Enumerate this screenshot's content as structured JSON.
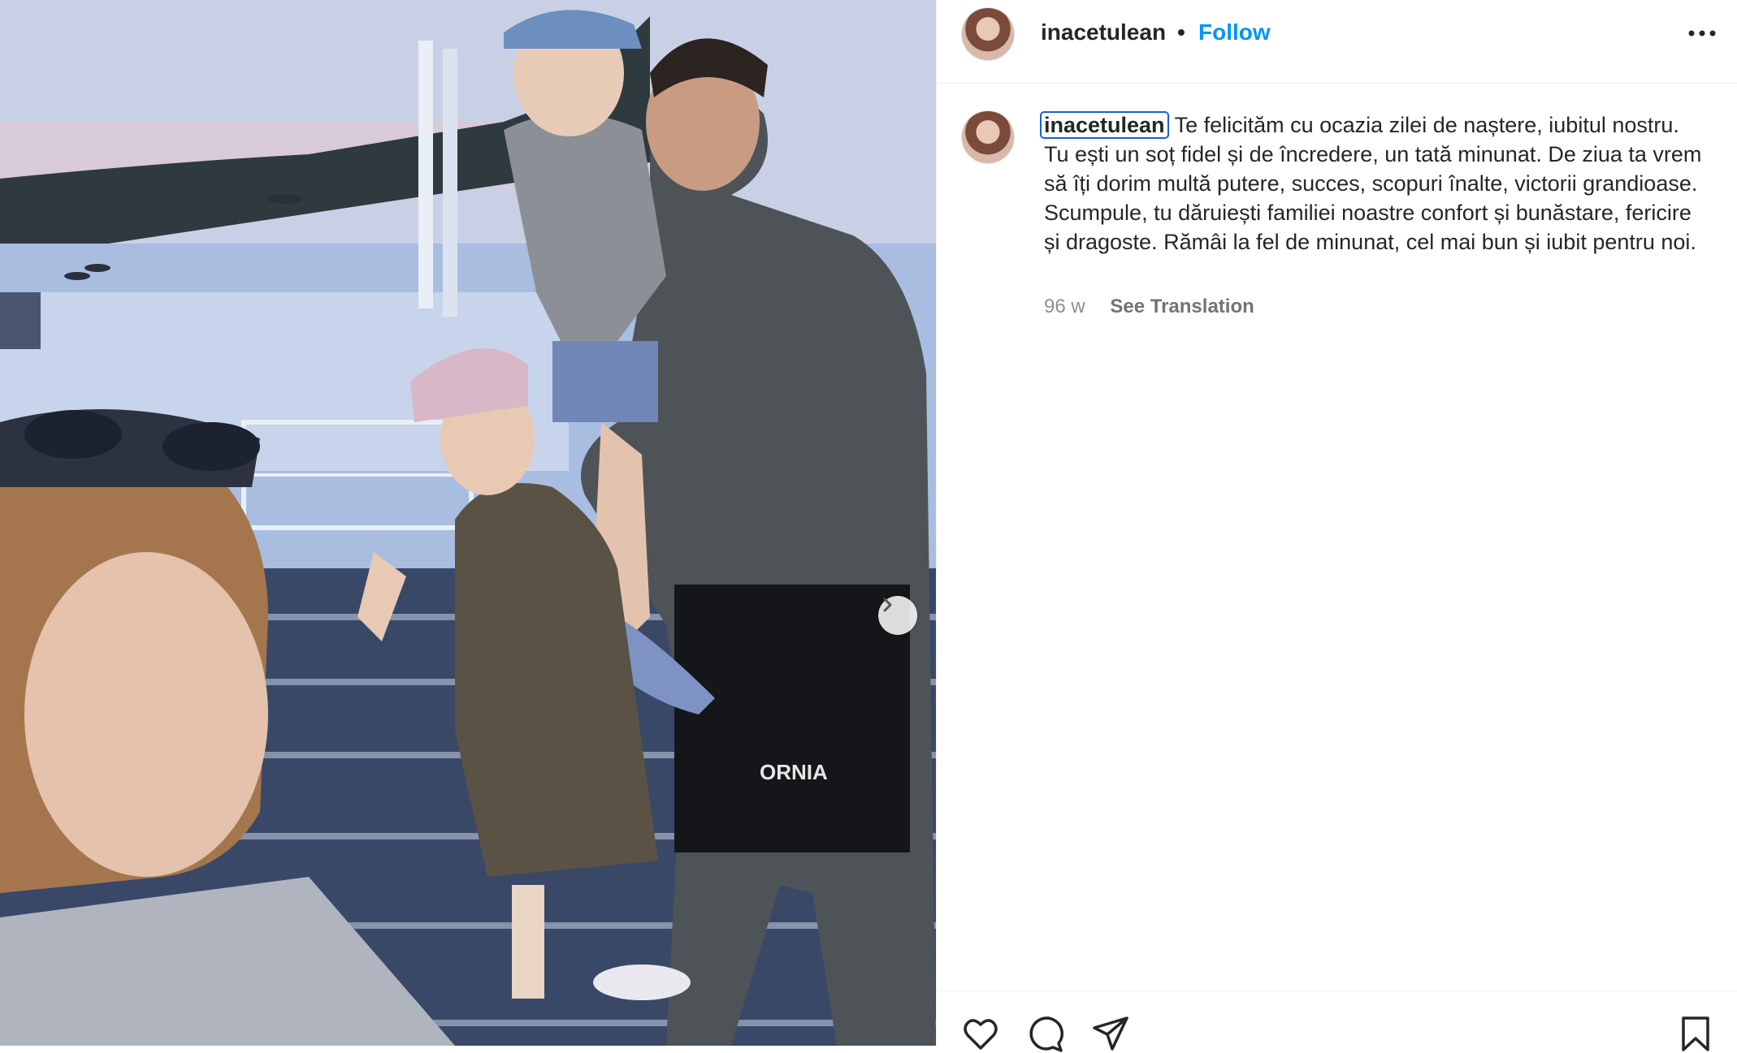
{
  "post": {
    "username": "inacetulean",
    "separator": "•",
    "follow_label": "Follow",
    "more_icon": "more-horizontal-icon",
    "caption_username": "inacetulean",
    "caption_text": "Te felicităm cu ocazia zilei de naștere, iubitul nostru. Tu ești un soț fidel și de încredere, un tată minunat. De ziua ta vrem să îți dorim multă putere, succes, scopuri înalte, victorii grandioase. Scumpule, tu dăruiești familiei noastre confort și bunăstare, fericire și dragoste. Rămâi la fel de minunat, cel mai bun și iubit pentru noi.",
    "time_ago": "96 w",
    "see_translation": "See Translation",
    "shorts_print": "ORNIA"
  },
  "actions": {
    "like_icon": "heart-icon",
    "comment_icon": "comment-icon",
    "share_icon": "share-icon",
    "save_icon": "bookmark-icon"
  },
  "carousel": {
    "next_icon": "chevron-right-icon"
  }
}
